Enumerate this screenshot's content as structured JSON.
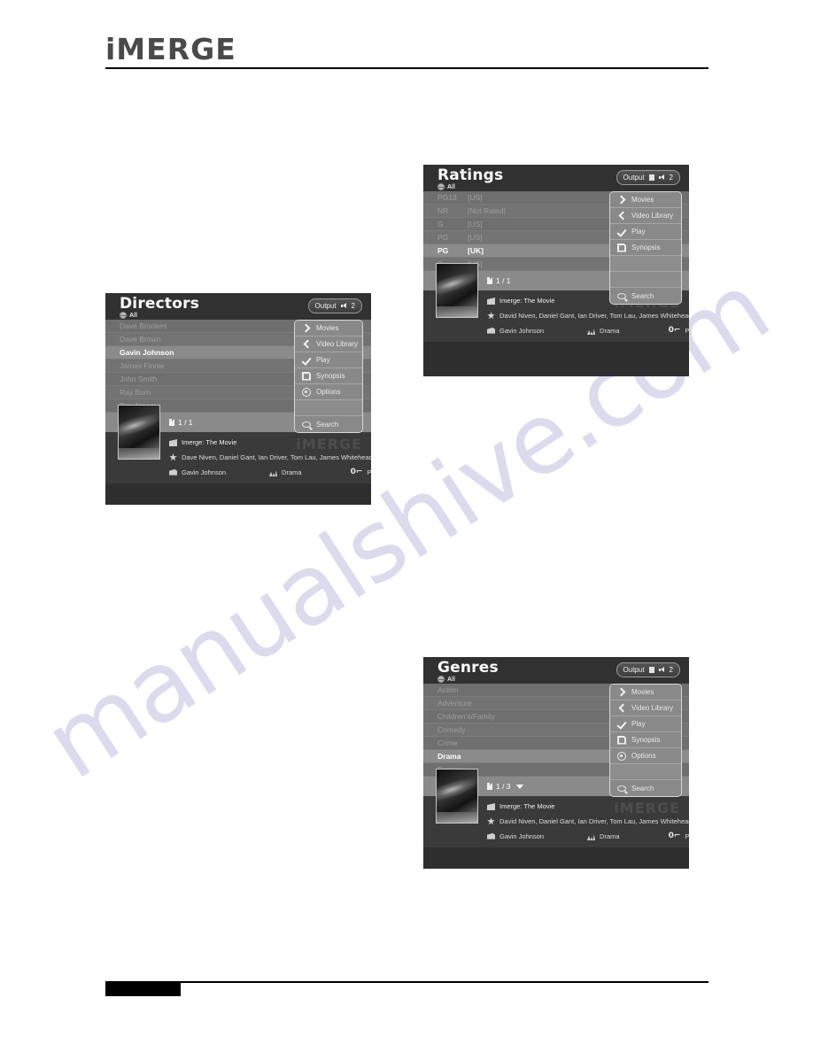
{
  "page": {
    "brand": "iMERGE",
    "watermark": "manualshive.com"
  },
  "menu_items": {
    "movies": "Movies",
    "video_library": "Video Library",
    "play": "Play",
    "synopsis": "Synopsis",
    "options": "Options",
    "search": "Search"
  },
  "output": {
    "label": "Output",
    "count": "2"
  },
  "screens": [
    {
      "id": "directors",
      "title": "Directors",
      "scope": "All",
      "output": {
        "label": "Output",
        "count": "2",
        "has_square": false
      },
      "rows": [
        {
          "key": "Dave Brookes",
          "value": "",
          "selected": false
        },
        {
          "key": "Dave Brown",
          "value": "",
          "selected": false
        },
        {
          "key": "Gavin Johnson",
          "value": "",
          "selected": true
        },
        {
          "key": "James Finnie",
          "value": "",
          "selected": false
        },
        {
          "key": "John Smith",
          "value": "",
          "selected": false
        },
        {
          "key": "Ray Burn",
          "value": "",
          "selected": false
        },
        {
          "key": "Tim Jones",
          "value": "",
          "selected": false
        }
      ],
      "page_indicator": "1 / 1",
      "has_more_chevron": false,
      "menu": [
        "Movies",
        "Video Library",
        "Play",
        "Synopsis",
        "Options",
        "",
        "Search"
      ],
      "info": {
        "title": "Imerge: The Movie",
        "cast": "Dave Niven, Daniel Gant, Ian Driver, Tom Lau, James Whitehead, J...",
        "director": "Gavin Johnson",
        "genre": "Drama",
        "rating": "PG",
        "ghost": "iMERGE"
      }
    },
    {
      "id": "ratings",
      "title": "Ratings",
      "scope": "All",
      "output": {
        "label": "Output",
        "count": "2",
        "has_square": true
      },
      "rows": [
        {
          "key": "PG13",
          "value": "[US]",
          "selected": false
        },
        {
          "key": "NR",
          "value": "[Not Rated]",
          "selected": false
        },
        {
          "key": "G",
          "value": "[US]",
          "selected": false
        },
        {
          "key": "PG",
          "value": "[US]",
          "selected": false
        },
        {
          "key": "PG",
          "value": "[UK]",
          "selected": true
        },
        {
          "key": "R",
          "value": "[US]",
          "selected": false
        }
      ],
      "page_indicator": "1 / 1",
      "has_more_chevron": false,
      "menu": [
        "Movies",
        "Video Library",
        "Play",
        "Synopsis",
        "",
        "",
        "Search"
      ],
      "info": {
        "title": "Imerge: The Movie",
        "cast": "David Niven, Daniel Gant, Ian Driver, Tom Lau, James Whitehead,...",
        "director": "Gavin Johnson",
        "genre": "Drama",
        "rating": "PG",
        "ghost": "iMERGE"
      }
    },
    {
      "id": "genres",
      "title": "Genres",
      "scope": "All",
      "output": {
        "label": "Output",
        "count": "2",
        "has_square": true
      },
      "rows": [
        {
          "key": "Action",
          "value": "",
          "selected": false
        },
        {
          "key": "Adventure",
          "value": "",
          "selected": false
        },
        {
          "key": "Children's/Family",
          "value": "",
          "selected": false
        },
        {
          "key": "Comedy",
          "value": "",
          "selected": false
        },
        {
          "key": "Crime",
          "value": "",
          "selected": false
        },
        {
          "key": "Drama",
          "value": "",
          "selected": true
        },
        {
          "key": "Fantasy",
          "value": "",
          "selected": false
        }
      ],
      "page_indicator": "1 / 3",
      "has_more_chevron": true,
      "menu": [
        "Movies",
        "Video Library",
        "Play",
        "Synopsis",
        "Options",
        "",
        "Search"
      ],
      "info": {
        "title": "Imerge: The Movie",
        "cast": "David Niven, Daniel Gant, Ian Driver, Tom Lau, James Whitehead,...",
        "director": "Gavin Johnson",
        "genre": "Drama",
        "rating": "PG",
        "ghost": "iMERGE"
      }
    }
  ]
}
